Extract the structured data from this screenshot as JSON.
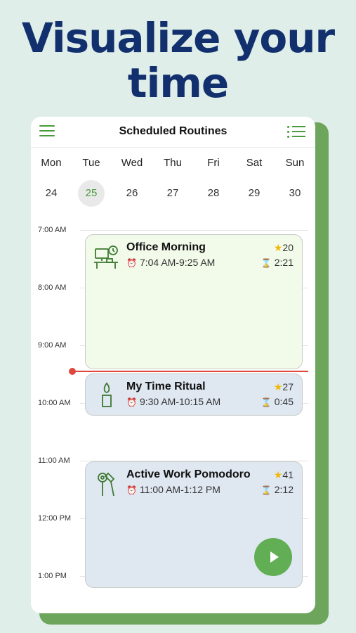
{
  "headline": {
    "line1": "Visualize your",
    "line2": "time"
  },
  "topbar": {
    "title": "Scheduled Routines",
    "menu_icon": "hamburger-menu-icon",
    "list_icon": "list-icon"
  },
  "week": {
    "days": [
      {
        "name": "Mon",
        "num": "24"
      },
      {
        "name": "Tue",
        "num": "25"
      },
      {
        "name": "Wed",
        "num": "26"
      },
      {
        "name": "Thu",
        "num": "27"
      },
      {
        "name": "Fri",
        "num": "28"
      },
      {
        "name": "Sat",
        "num": "29"
      },
      {
        "name": "Sun",
        "num": "30"
      }
    ],
    "selected_index": 1
  },
  "timeline": {
    "hours": [
      "7:00 AM",
      "8:00 AM",
      "9:00 AM",
      "10:00 AM",
      "11:00 AM",
      "12:00 PM",
      "1:00 PM"
    ]
  },
  "events": [
    {
      "name": "Office Morning",
      "time": "7:04 AM-9:25 AM",
      "stars": "20",
      "duration": "2:21",
      "icon": "desk-clock-icon",
      "color": "#f2fbea"
    },
    {
      "name": "My Time Ritual",
      "time": "9:30 AM-10:15 AM",
      "stars": "27",
      "duration": "0:45",
      "icon": "candle-icon",
      "color": "#dfe7f1"
    },
    {
      "name": "Active Work Pomodoro",
      "time": "11:00 AM-1:12 PM",
      "stars": "41",
      "duration": "2:12",
      "icon": "tools-icon",
      "color": "#dfe7f1"
    }
  ],
  "colors": {
    "accent": "#4a9b3c",
    "now_line": "#e0473d",
    "headline": "#12306e",
    "play": "#62ae55"
  }
}
